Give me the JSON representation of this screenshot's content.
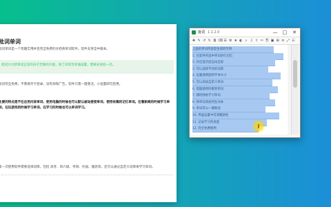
{
  "doc": {
    "title": "批词单词",
    "paragraphs": [
      "批词单词是一个有趣实用并且完全免费的文档英单词软件，软件支持全中版本。",
      "批词大大新单词正常的日子无聊的只能，除了日常可背诵 设置，实际更多运用到平时生活中。",
      "批词完全免费，不需要开卡登录，没有烦琐广告，软件只需一键激活，小设置即可启用。",
      "主要的特点是不在应用内背单词，使用电脑的时候也可以默认被动接受单词，使用有趣的记忆单词。在看新闻的时候学习单词，在玩游戏的时候学习单词，在学习的时候也可以单词学习。",
      "第一次使用软件需要选择词库，包括 高考、四六级、考研、托福、雅思等，还可以通过自定义词库来学习单词。"
    ],
    "quote": "批词大大新单词正常的日子无聊的只能，除了日常可背诵设置，需要去体验一次。"
  },
  "notepad": {
    "app_name": "批词",
    "version": "1.1.2.0",
    "minimize": "—",
    "maximize": "□",
    "close": "✕",
    "toolbar_icons": [
      "✚",
      "✎",
      "↺",
      "↻",
      "⧉",
      "⌫",
      "☰",
      "⚙",
      "★",
      "◐",
      "⌕",
      "⇩",
      "⇧",
      "✂",
      "⎘",
      "▣",
      "⊞",
      "≡",
      "⤢",
      "☷"
    ],
    "lines": [
      "上面的单词内容是生成的示例",
      "1. 在软件内选中单词进行记忆",
      "2. 开启显示后自动出现",
      "3. 可以选择不同的词库",
      "4. 设置透明度和字体大小",
      "5. 可以添加自定义单词",
      "6. 电脑使用时看到单词",
      "7. 随时随地学习单词",
      "8. 将单词添加到生词本",
      "9. 单词可以一键朗读",
      "10. 界面设置中可调整颜色",
      "11. 记录学习的进度",
      "12. 完全免费使用"
    ]
  },
  "colors": {
    "bg_start": "#07bf8c",
    "bg_end": "#1b8fd8",
    "selection": "#a7c9f1",
    "accent": "#20a24a"
  },
  "icons": {
    "cursor": "cursor-highlight-icon",
    "app": "app-logo-icon"
  }
}
